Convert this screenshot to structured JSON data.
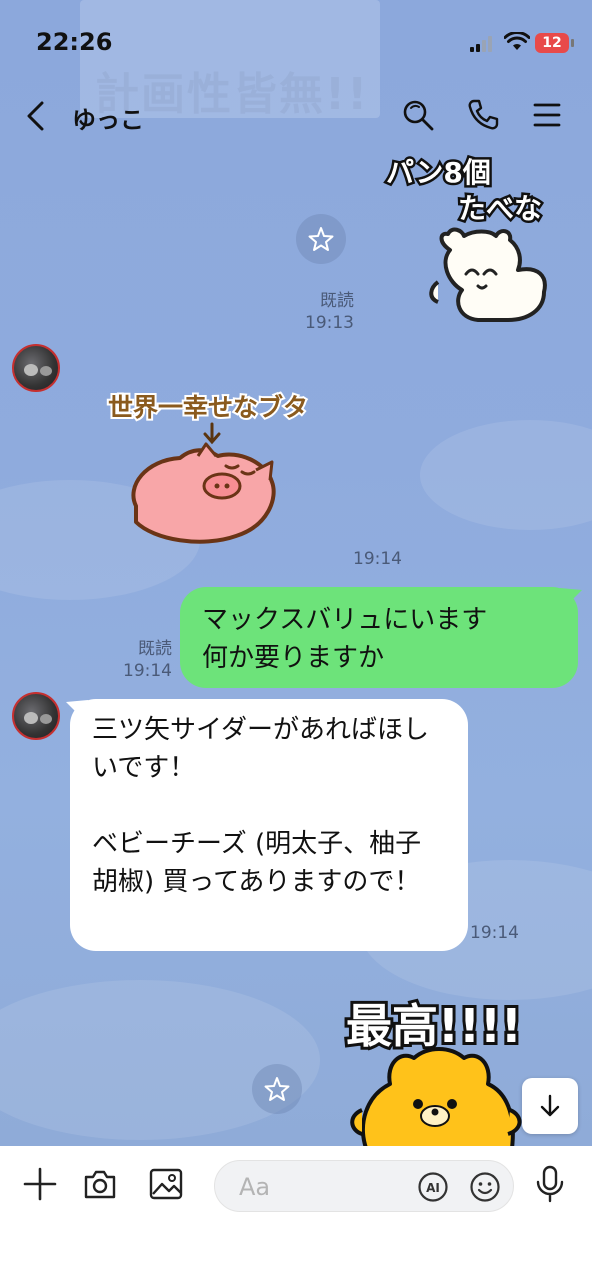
{
  "status": {
    "time": "22:26",
    "battery": "12"
  },
  "header": {
    "contact_name": "ゆっこ"
  },
  "background": {
    "banner_text": "計画性皆無!!"
  },
  "messages": [
    {
      "id": "m1",
      "type": "sticker",
      "side": "right",
      "sticker_text": [
        "パン8個",
        "たべな"
      ],
      "read": "既読",
      "time": "19:13"
    },
    {
      "id": "m2",
      "type": "sticker",
      "side": "left",
      "sticker_text": [
        "世界一幸せなブタ"
      ],
      "time": "19:14"
    },
    {
      "id": "m3",
      "type": "text",
      "side": "right",
      "lines": [
        "マックスバリュにいます",
        "何か要りますか"
      ],
      "read": "既読",
      "time": "19:14"
    },
    {
      "id": "m4",
      "type": "text",
      "side": "left",
      "paragraphs": [
        "三ツ矢サイダーがあればほしいです！",
        "ベビーチーズ (明太子、柚子胡椒) 買ってありますので！"
      ],
      "time": "19:14"
    },
    {
      "id": "m5",
      "type": "sticker",
      "side": "right",
      "sticker_text": [
        "最高!!!!"
      ]
    }
  ],
  "input": {
    "placeholder": "Aa",
    "ai_label": "AI"
  },
  "colors": {
    "background": "#8fabdc",
    "sent_bubble": "#6de37a",
    "received_bubble": "#ffffff",
    "battery": "#e84a4a"
  },
  "icons": [
    "back-chevron-icon",
    "search-icon",
    "phone-icon",
    "menu-icon",
    "star-icon",
    "plus-icon",
    "camera-icon",
    "image-icon",
    "ai-icon",
    "emoji-icon",
    "microphone-icon",
    "arrow-down-icon"
  ]
}
